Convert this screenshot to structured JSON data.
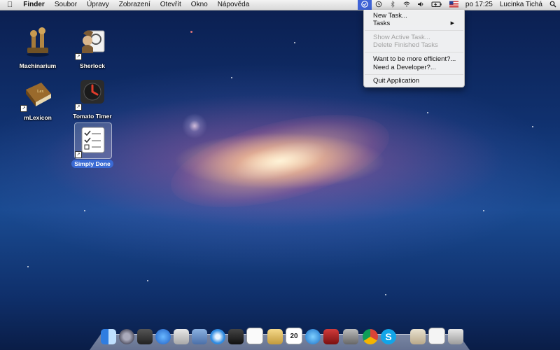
{
  "menubar": {
    "apple_icon": "apple-logo-icon",
    "items": [
      "Finder",
      "Soubor",
      "Úpravy",
      "Zobrazení",
      "Otevřít",
      "Okno",
      "Nápověda"
    ],
    "status": {
      "app_icon": "check-circle-icon",
      "time_machine_icon": "time-machine-icon",
      "bluetooth_icon": "bluetooth-icon",
      "wifi_icon": "wifi-icon",
      "volume_icon": "speaker-icon",
      "battery_icon": "battery-icon",
      "flag_icon": "us-flag-icon",
      "clock": "po 17:25",
      "user": "Lucinka Tichá",
      "spotlight_icon": "magnifier-icon"
    }
  },
  "dropdown": {
    "new_task": "New Task...",
    "tasks": "Tasks",
    "show_active": "Show Active Task...",
    "delete_finished": "Delete Finished Tasks",
    "efficient": "Want to be more efficient?...",
    "developer": "Need a Developer?...",
    "quit": "Quit Application"
  },
  "desktop_icons": {
    "machinarium": "Machinarium",
    "sherlock": "Sherlock",
    "mlexicon": "mLexicon",
    "tomato_timer": "Tomato Timer",
    "simply_done": "Simply Done"
  },
  "dock": {
    "icons": [
      "finder",
      "launchpad",
      "mission-control",
      "app-store",
      "preview",
      "address-book",
      "safari",
      "photo-booth",
      "simply-done",
      "notes",
      "calendar",
      "itunes",
      "photo",
      "system-preferences",
      "chrome",
      "skype",
      "document",
      "file",
      "trash"
    ],
    "calendar_date": "20"
  },
  "colors": {
    "menu_highlight": "#3f63d6",
    "selection": "#3a6ad4"
  }
}
